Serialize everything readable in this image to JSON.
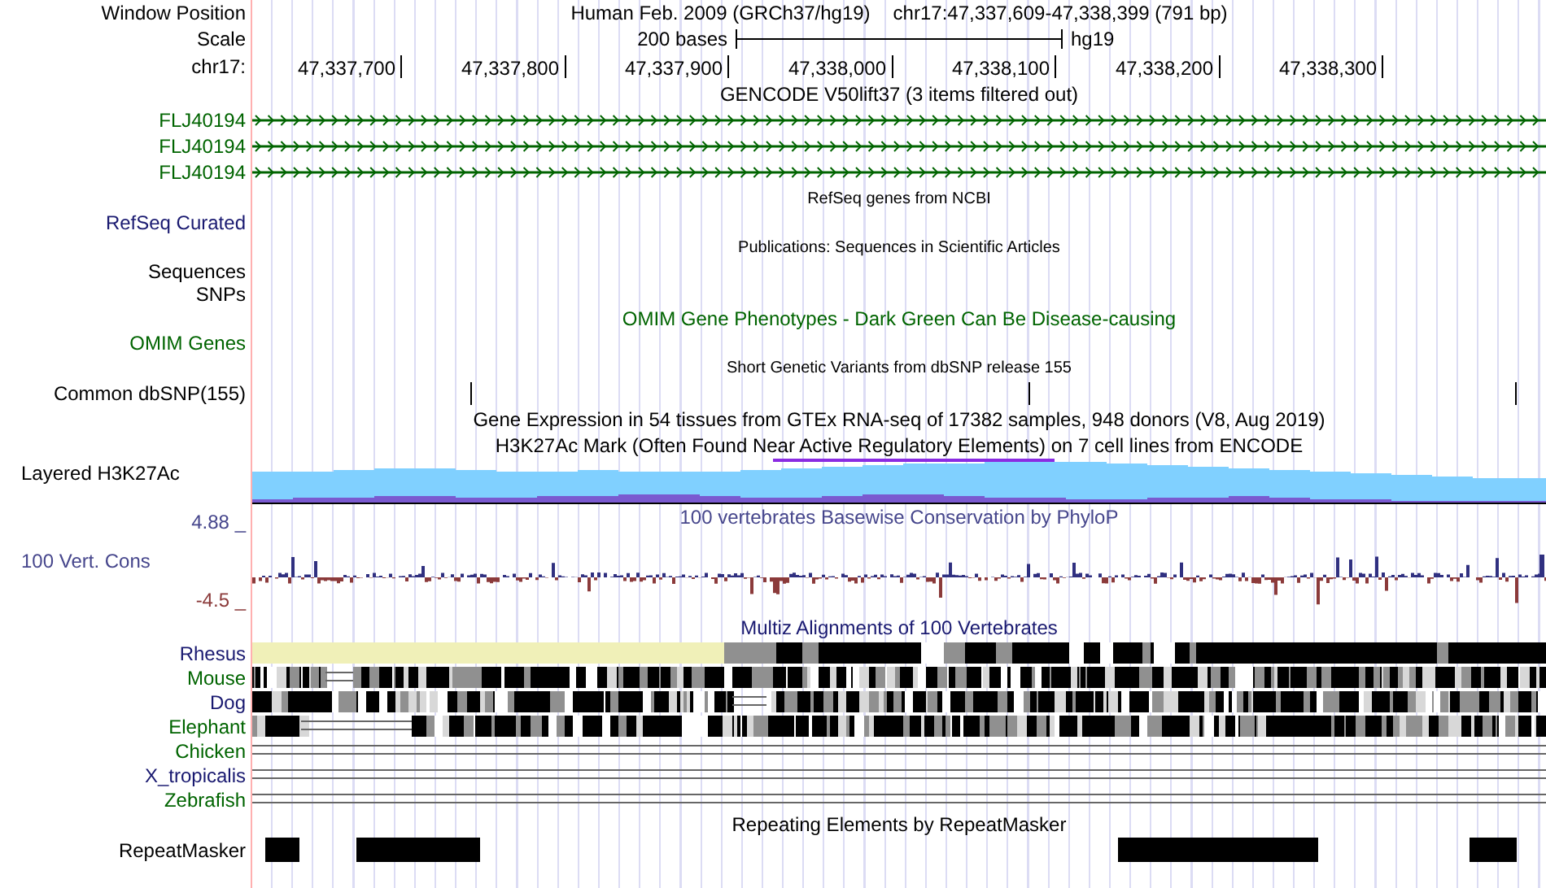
{
  "header": {
    "label": "Window Position",
    "title": "Human Feb. 2009 (GRCh37/hg19)",
    "position": "chr17:47,337,609-47,338,399 (791 bp)"
  },
  "scale": {
    "label": "Scale",
    "length": "200 bases",
    "assembly": "hg19"
  },
  "ruler": {
    "label": "chr17:",
    "ticks": [
      "47,337,700",
      "47,337,800",
      "47,337,900",
      "47,338,000",
      "47,338,100",
      "47,338,200",
      "47,338,300"
    ]
  },
  "tracks": [
    {
      "kind": "title",
      "title": "GENCODE V50lift37 (3 items filtered out)"
    },
    {
      "kind": "gene",
      "label": "FLJ40194",
      "color": "#006400"
    },
    {
      "kind": "gene",
      "label": "FLJ40194",
      "color": "#006400"
    },
    {
      "kind": "gene",
      "label": "FLJ40194",
      "color": "#006400"
    },
    {
      "kind": "note",
      "title": "RefSeq genes from NCBI"
    },
    {
      "kind": "label",
      "label": "RefSeq Curated",
      "color": "#191970"
    },
    {
      "kind": "note",
      "title": "Publications: Sequences in Scientific Articles"
    },
    {
      "kind": "label",
      "label": "Sequences",
      "color": "#000000"
    },
    {
      "kind": "label",
      "label": "SNPs",
      "color": "#000000"
    },
    {
      "kind": "title",
      "title": "OMIM Gene Phenotypes - Dark Green Can Be Disease-causing",
      "color": "#006400"
    },
    {
      "kind": "label",
      "label": "OMIM Genes",
      "color": "#006400"
    },
    {
      "kind": "note",
      "title": "Short Genetic Variants from dbSNP release 155"
    },
    {
      "kind": "snp",
      "label": "Common dbSNP(155)",
      "color": "#000000"
    },
    {
      "kind": "title",
      "title": "Gene Expression in 54 tissues from GTEx RNA-seq of 17382 samples, 948 donors (V8, Aug 2019)"
    },
    {
      "kind": "title",
      "title": "H3K27Ac Mark (Often Found Near Active Regulatory Elements) on 7 cell lines from ENCODE"
    },
    {
      "kind": "signal",
      "label": "Layered H3K27Ac",
      "color": "#000000"
    },
    {
      "kind": "wiggle",
      "title": "100 vertebrates Basewise Conservation by PhyloP",
      "label": "100 Vert. Cons",
      "max": "4.88 _",
      "min": "-4.5 _",
      "color": "#46468c"
    },
    {
      "kind": "title",
      "title": "Multiz Alignments of 100 Vertebrates",
      "color": "#191970"
    },
    {
      "kind": "conserved",
      "label": "Rhesus",
      "color": "#191970"
    },
    {
      "kind": "aligned",
      "label": "Mouse",
      "color": "#006400"
    },
    {
      "kind": "aligned",
      "label": "Dog",
      "color": "#191970"
    },
    {
      "kind": "aligned",
      "label": "Elephant",
      "color": "#006400"
    },
    {
      "kind": "unaligned",
      "label": "Chicken",
      "color": "#006400"
    },
    {
      "kind": "unaligned",
      "label": "X_tropicalis",
      "color": "#191970"
    },
    {
      "kind": "unaligned",
      "label": "Zebrafish",
      "color": "#006400"
    },
    {
      "kind": "title",
      "title": "Repeating Elements by RepeatMasker"
    },
    {
      "kind": "repeat",
      "label": "RepeatMasker",
      "color": "#000000"
    }
  ]
}
